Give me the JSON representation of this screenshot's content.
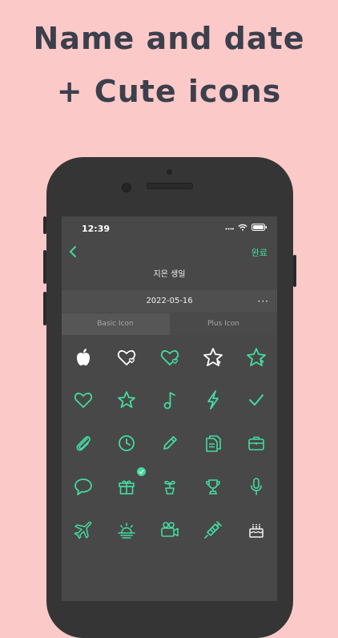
{
  "headline": {
    "line1": "Name and date",
    "line2": "+ Cute icons"
  },
  "status": {
    "time": "12:39"
  },
  "nav": {
    "done_label": "완료"
  },
  "form": {
    "name": "지은 생일",
    "date": "2022-05-16",
    "more": "···"
  },
  "tabs": [
    {
      "label": "Basic Icon"
    },
    {
      "label": "Plus Icon"
    }
  ],
  "colors": {
    "accent": "#43dba0",
    "background": "#fcc9c9",
    "screen": "#484848"
  },
  "icons": [
    [
      "apple-icon",
      "heart-outline-icon",
      "heart-double-icon",
      "star-outline-icon",
      "star-double-icon"
    ],
    [
      "heart-icon",
      "star-icon",
      "music-note-icon",
      "lightning-icon",
      "check-icon"
    ],
    [
      "paperclip-icon",
      "clock-icon",
      "pencil-icon",
      "documents-icon",
      "briefcase-icon"
    ],
    [
      "speech-bubble-icon",
      "gift-icon",
      "plant-icon",
      "trophy-icon",
      "microphone-icon"
    ],
    [
      "airplane-icon",
      "sunrise-icon",
      "video-camera-icon",
      "syringe-icon",
      "cake-icon"
    ]
  ],
  "selected_icon": "gift-icon"
}
